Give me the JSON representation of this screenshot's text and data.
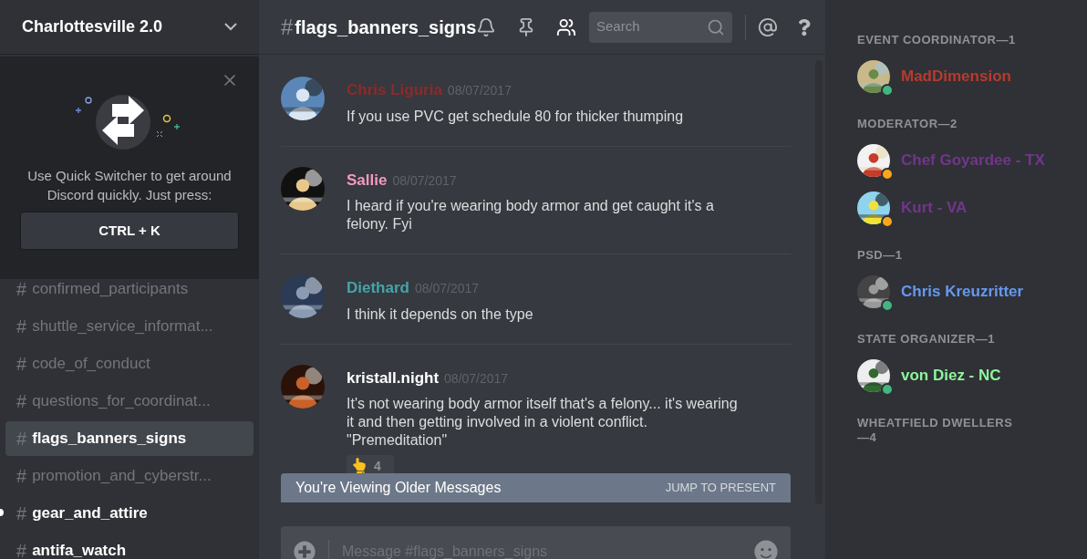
{
  "server": {
    "name": "Charlottesville 2.0"
  },
  "quick_switcher": {
    "text": "Use Quick Switcher to get around Discord quickly. Just press:",
    "shortcut": "CTRL + K"
  },
  "channels": [
    {
      "hash": "#",
      "name": "confirmed_participants",
      "selected": false,
      "unread": false
    },
    {
      "hash": "#",
      "name": "shuttle_service_informat...",
      "selected": false,
      "unread": false
    },
    {
      "hash": "#",
      "name": "code_of_conduct",
      "selected": false,
      "unread": false
    },
    {
      "hash": "#",
      "name": "questions_for_coordinat...",
      "selected": false,
      "unread": false
    },
    {
      "hash": "#",
      "name": "flags_banners_signs",
      "selected": true,
      "unread": false
    },
    {
      "hash": "#",
      "name": "promotion_and_cyberstr...",
      "selected": false,
      "unread": false
    },
    {
      "hash": "#",
      "name": "gear_and_attire",
      "selected": false,
      "unread": true
    },
    {
      "hash": "#",
      "name": "antifa_watch",
      "selected": false,
      "unread": true
    }
  ],
  "channel_header": {
    "hash": "#",
    "name": "flags_banners_signs",
    "search_placeholder": "Search"
  },
  "messages": [
    {
      "author": "Chris Liguria",
      "color": "#8c2a2c",
      "time": "08/07/2017",
      "text": "If you use PVC get schedule 80 for thicker thumping"
    },
    {
      "author": "Sallie",
      "color": "#f49ac1",
      "time": "08/07/2017",
      "text": "I heard if you're wearing body armor and get caught it's a felony.  Fyi"
    },
    {
      "author": "Diethard",
      "color": "#44a5a8",
      "time": "08/07/2017",
      "text": "I think it depends on the type"
    },
    {
      "author": "kristall.night",
      "color": "#ffffff",
      "time": "08/07/2017",
      "text": "It's not wearing body armor itself that's a felony... it's wearing it and then getting involved in a violent conflict. \"Premeditation\"",
      "reaction": {
        "count": "4"
      }
    }
  ],
  "older_banner": {
    "text": "You're Viewing Older Messages",
    "action": "JUMP TO PRESENT"
  },
  "composer": {
    "placeholder": "Message #flags_banners_signs"
  },
  "member_groups": [
    {
      "title": "EVENT COORDINATOR—1",
      "members": [
        {
          "name": "MadDimension",
          "color": "#b83a2e",
          "idle": false
        }
      ]
    },
    {
      "title": "MODERATOR—2",
      "members": [
        {
          "name": "Chef Goyardee - TX",
          "color": "#71368a",
          "idle": true
        },
        {
          "name": "Kurt - VA",
          "color": "#71368a",
          "idle": true
        }
      ]
    },
    {
      "title": "PSD—1",
      "members": [
        {
          "name": "Chris Kreuzritter",
          "color": "#6698f0",
          "idle": false
        }
      ]
    },
    {
      "title": "STATE ORGANIZER—1",
      "members": [
        {
          "name": "von Diez - NC",
          "color": "#8ef59c",
          "idle": false
        }
      ]
    },
    {
      "title": "WHEATFIELD DWELLERS—4"
    }
  ]
}
